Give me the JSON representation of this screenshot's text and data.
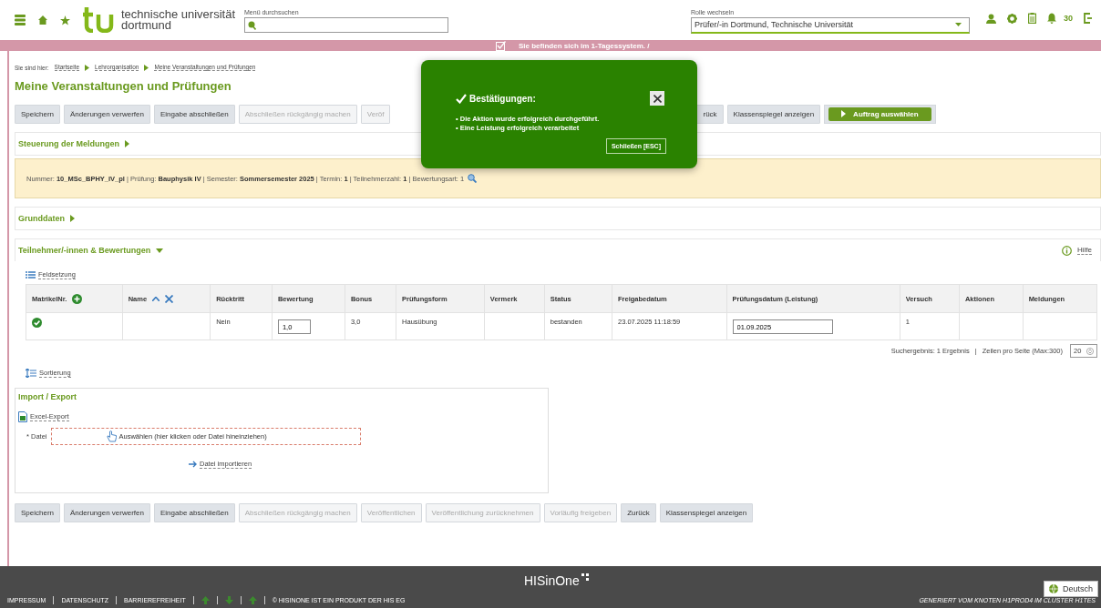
{
  "header": {
    "logo_line1": "technische universität",
    "logo_line2": "dortmund",
    "menu_search": {
      "label": "Menü durchsuchen"
    },
    "role": {
      "label": "Rolle wechseln",
      "value": "Prüfer/-in Dortmund, Technische Universität"
    },
    "notification_count": "30"
  },
  "system_banner": "Sie befinden sich im 1-Tagessystem. /",
  "breadcrumb": {
    "prefix": "Sie sind hier:",
    "items": [
      "Startseite",
      "Lehrorganisation",
      "Meine Veranstaltungen und Prüfungen"
    ]
  },
  "page_title": "Meine Veranstaltungen und Prüfungen",
  "top_toolbar": {
    "before_popup": [
      {
        "label": "Speichern",
        "disabled": false
      },
      {
        "label": "Änderungen verwerfen",
        "disabled": false
      },
      {
        "label": "Eingabe abschließen",
        "disabled": false
      },
      {
        "label": "Abschließen rückgängig machen",
        "disabled": true
      },
      {
        "label": "Veröf",
        "disabled": true
      }
    ],
    "after_popup": [
      {
        "label": "rück",
        "disabled": false
      },
      {
        "label": "Klassenspiegel anzeigen",
        "disabled": false
      }
    ],
    "primary": "Auftrag auswählen"
  },
  "popup": {
    "title": "Bestätigungen:",
    "messages": [
      "• Die Aktion wurde erfolgreich durchgeführt.",
      "• Eine Leistung erfolgreich verarbeitet"
    ],
    "close_button": "Schließen [ESC]"
  },
  "sections": [
    {
      "title": "Steuerung der Meldungen",
      "expanded": false
    },
    {
      "kind": "info",
      "text": "Nummer: **10_MSc_BPHY_IV_pl** | Prüfung: **Bauphysik IV** | Semester: **Sommersemester 2025** | Termin: **1** | Teilnehmerzahl: **1** | Bewertungsart: 1"
    },
    {
      "title": "Grunddaten",
      "expanded": false
    },
    {
      "title": "Teilnehmer/-innen & Bewertungen",
      "expanded": true
    }
  ],
  "help_link": "Hilfe",
  "field_setting_link": "Feldsetzung",
  "table": {
    "columns": [
      "MatrikelNr.",
      "Name",
      "Rücktritt",
      "Bewertung",
      "Bonus",
      "Prüfungsform",
      "Vermerk",
      "Status",
      "Freigabedatum",
      "Prüfungsdatum (Leistung)",
      "Versuch",
      "Aktionen",
      "Meldungen"
    ],
    "rows": [
      {
        "cells": [
          {
            "kind": "icon"
          },
          {
            "kind": "empty"
          },
          {
            "kind": "text",
            "text": "Nein"
          },
          {
            "kind": "input",
            "value": "1,0"
          },
          {
            "kind": "text",
            "text": "3,0"
          },
          {
            "kind": "text",
            "text": "Hausübung"
          },
          {
            "kind": "empty"
          },
          {
            "kind": "text",
            "text": "bestanden"
          },
          {
            "kind": "text",
            "text": "23.07.2025 11:18:59"
          },
          {
            "kind": "input",
            "value": "01.09.2025"
          },
          {
            "kind": "text",
            "text": "1"
          },
          {
            "kind": "empty"
          },
          {
            "kind": "empty"
          }
        ]
      }
    ]
  },
  "pagination": {
    "result": "Suchergebnis: 1 Ergebnis",
    "separator": "|",
    "per_page_label": "Zeilen pro Seite (Max:300)",
    "per_page": "20"
  },
  "sort_link": "Sortierung",
  "import_export": {
    "title": "Import / Export",
    "excel_link": "Excel-Export",
    "file_label": "* Datei",
    "drop_zone": "Auswählen (hier klicken oder Datei hineinziehen)",
    "import_link": "Datei importieren"
  },
  "bottom_toolbar": [
    {
      "label": "Speichern",
      "disabled": false
    },
    {
      "label": "Änderungen verwerfen",
      "disabled": false
    },
    {
      "label": "Eingabe abschließen",
      "disabled": false
    },
    {
      "label": "Abschließen rückgängig machen",
      "disabled": true
    },
    {
      "label": "Veröffentlichen",
      "disabled": true
    },
    {
      "label": "Veröffentlichung zurücknehmen",
      "disabled": true
    },
    {
      "label": "Vorläufig freigeben",
      "disabled": true
    },
    {
      "label": "Zurück",
      "disabled": false
    },
    {
      "label": "Klassenspiegel anzeigen",
      "disabled": false
    }
  ],
  "footer": {
    "logo": "HISinOne",
    "links": [
      "IMPRESSUM",
      "DATENSCHUTZ",
      "BARRIEREFREIHEIT"
    ],
    "copyright": "© HISINONE IST EIN PRODUKT DER HIS EG",
    "node_info": "GENERIERT VOM KNOTEN H1PROD4 IM CLUSTER H1TES",
    "language": "Deutsch"
  }
}
